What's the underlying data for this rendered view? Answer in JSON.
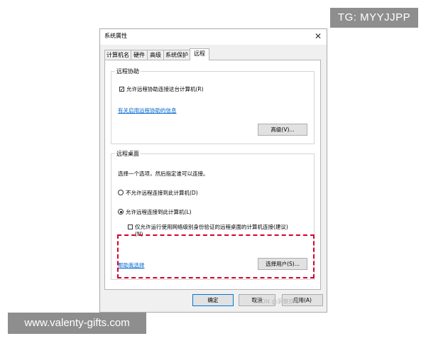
{
  "watermarks": {
    "top": "TG: MYYJJPP",
    "bottom": "www.valenty-gifts.com",
    "csdn": "CSDN @洞察玖零"
  },
  "window": {
    "title": "系统属性",
    "close_glyph": "✕"
  },
  "tabs": [
    {
      "label": "计算机名",
      "active": false
    },
    {
      "label": "硬件",
      "active": false
    },
    {
      "label": "高级",
      "active": false
    },
    {
      "label": "系统保护",
      "active": false
    },
    {
      "label": "远程",
      "active": true
    }
  ],
  "remote_assistance": {
    "group_label": "远程协助",
    "allow_checkbox_label": "允许远程协助连接这台计算机(R)",
    "allow_checked": true,
    "info_link": "有关启用远程协助的信息",
    "advanced_button": "高级(V)..."
  },
  "remote_desktop": {
    "group_label": "远程桌面",
    "instruction": "选择一个选项，然后指定谁可以连接。",
    "option_disallow": "不允许远程连接到此计算机(D)",
    "option_allow": "允许远程连接到此计算机(L)",
    "selected_option": "allow",
    "nla_label_line1": "仅允许运行使用网络级别身份验证的远程桌面的计算机连接(建议)",
    "nla_label_line2": "(N)",
    "nla_checked": false,
    "help_link": "帮助我选择",
    "select_users_button": "选择用户(S)..."
  },
  "footer": {
    "ok": "确定",
    "cancel": "取消",
    "apply": "应用(A)"
  },
  "colors": {
    "link": "#0066cc",
    "highlight_dash": "#d6002a",
    "primary_border": "#0078d7",
    "watermark_bg": "#8e8e8e"
  }
}
